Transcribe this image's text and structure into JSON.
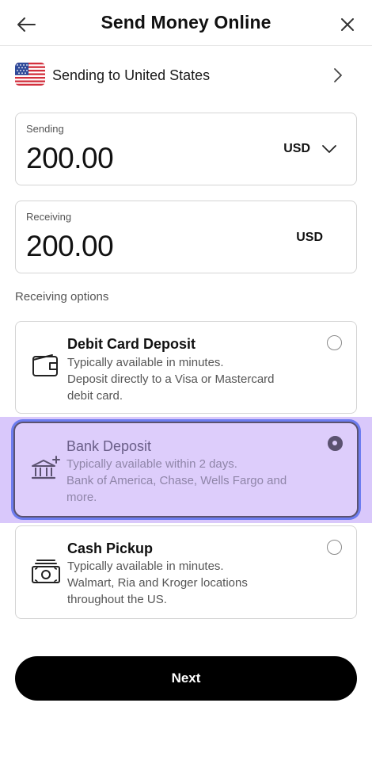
{
  "header": {
    "title": "Send Money Online",
    "back_icon": "arrow-left-icon",
    "close_icon": "close-icon"
  },
  "destination": {
    "label": "Sending to United States",
    "flag_icon": "us-flag-icon",
    "chevron_icon": "chevron-right-icon"
  },
  "sending": {
    "caption": "Sending",
    "amount": "200.00",
    "currency": "USD"
  },
  "receiving": {
    "caption": "Receiving",
    "amount": "200.00",
    "currency": "USD"
  },
  "receiving_options": {
    "label": "Receiving options",
    "items": [
      {
        "title": "Debit Card Deposit",
        "line1": "Typically available in minutes.",
        "line2": "Deposit directly to a Visa or Mastercard",
        "line3": "debit card.",
        "icon": "wallet-icon",
        "selected": false
      },
      {
        "title": "Bank Deposit",
        "line1": "Typically available within 2 days.",
        "line2": "Bank of America, Chase, Wells Fargo and",
        "line3": "more.",
        "icon": "bank-plus-icon",
        "selected": true
      },
      {
        "title": "Cash Pickup",
        "line1": "Typically available in minutes.",
        "line2": "Walmart, Ria and Kroger locations",
        "line3": "throughout the US.",
        "icon": "cash-icon",
        "selected": false
      }
    ]
  },
  "actions": {
    "next_label": "Next"
  },
  "colors": {
    "accent_highlight": "#d9c8fb",
    "selected_focus_ring": "#6c7cf0",
    "primary_button": "#000000"
  }
}
